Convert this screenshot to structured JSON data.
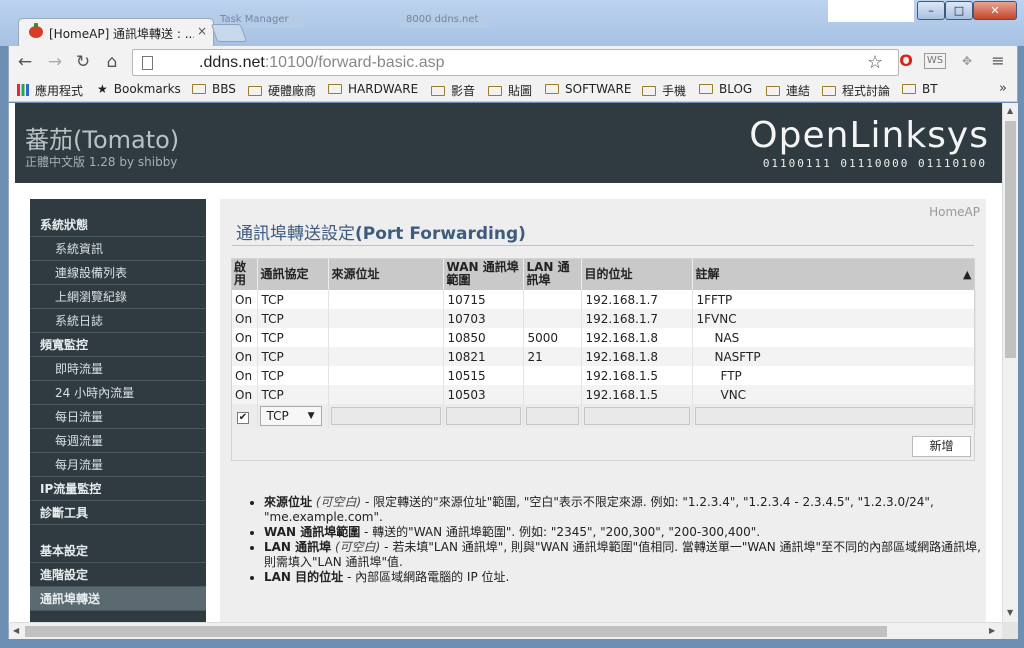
{
  "browser": {
    "tab_title": "[HomeAP] 通訊埠轉送 : ...",
    "tab_close": "×",
    "ghost_tabs": [
      "Task Manager",
      "8000 ddns.net"
    ],
    "url_host": ".ddns.net",
    "url_path": ":10100/forward-basic.asp",
    "bookmarks": [
      {
        "label": "應用程式",
        "type": "apps"
      },
      {
        "label": "Bookmarks",
        "type": "star"
      },
      {
        "label": "BBS",
        "type": "folder"
      },
      {
        "label": "硬體廠商",
        "type": "folder"
      },
      {
        "label": "HARDWARE",
        "type": "folder"
      },
      {
        "label": "影音",
        "type": "folder"
      },
      {
        "label": "貼圖",
        "type": "folder"
      },
      {
        "label": "SOFTWARE",
        "type": "folder"
      },
      {
        "label": "手機",
        "type": "folder"
      },
      {
        "label": "BLOG",
        "type": "folder"
      },
      {
        "label": "連結",
        "type": "folder"
      },
      {
        "label": "程式討論",
        "type": "folder"
      },
      {
        "label": "BT",
        "type": "folder"
      }
    ],
    "more": "»"
  },
  "header": {
    "brand": "蕃茄(Tomato)",
    "subtitle": "正體中文版 1.28 by shibby",
    "logo": "OpenLinksys",
    "logo_binary": "01100111 01110000 01110100"
  },
  "sidebar": [
    {
      "label": "系統狀態",
      "kind": "head"
    },
    {
      "label": "系統資訊",
      "kind": "sub"
    },
    {
      "label": "連線設備列表",
      "kind": "sub"
    },
    {
      "label": "上網瀏覽紀錄",
      "kind": "sub"
    },
    {
      "label": "系統日誌",
      "kind": "sub"
    },
    {
      "label": "頻寬監控",
      "kind": "head"
    },
    {
      "label": "即時流量",
      "kind": "sub"
    },
    {
      "label": "24 小時內流量",
      "kind": "sub"
    },
    {
      "label": "每日流量",
      "kind": "sub"
    },
    {
      "label": "每週流量",
      "kind": "sub"
    },
    {
      "label": "每月流量",
      "kind": "sub"
    },
    {
      "label": "IP流量監控",
      "kind": "head"
    },
    {
      "label": "診斷工具",
      "kind": "head"
    },
    {
      "label": "基本設定",
      "kind": "head"
    },
    {
      "label": "進階設定",
      "kind": "head"
    },
    {
      "label": "通訊埠轉送",
      "kind": "head active"
    }
  ],
  "content": {
    "breadcrumb": "HomeAP",
    "title_zh": "通訊埠轉送設定",
    "title_en": "(Port Forwarding)",
    "columns": [
      "啟用",
      "通訊協定",
      "來源位址",
      "WAN 通訊埠範圍",
      "LAN 通訊埠",
      "目的位址",
      "註解"
    ],
    "sort_indicator": "▲",
    "rows": [
      {
        "on": "On",
        "proto": "TCP",
        "src": "",
        "wan": "10715",
        "lan": "",
        "dest": "192.168.1.7",
        "note": "1FFTP"
      },
      {
        "on": "On",
        "proto": "TCP",
        "src": "",
        "wan": "10703",
        "lan": "",
        "dest": "192.168.1.7",
        "note": "1FVNC"
      },
      {
        "on": "On",
        "proto": "TCP",
        "src": "",
        "wan": "10850",
        "lan": "5000",
        "dest": "192.168.1.8",
        "note": "NAS"
      },
      {
        "on": "On",
        "proto": "TCP",
        "src": "",
        "wan": "10821",
        "lan": "21",
        "dest": "192.168.1.8",
        "note": "NASFTP"
      },
      {
        "on": "On",
        "proto": "TCP",
        "src": "",
        "wan": "10515",
        "lan": "",
        "dest": "192.168.1.5",
        "note": "FTP"
      },
      {
        "on": "On",
        "proto": "TCP",
        "src": "",
        "wan": "10503",
        "lan": "",
        "dest": "192.168.1.5",
        "note": "VNC"
      }
    ],
    "new_row": {
      "checkbox": "✔",
      "proto": "TCP",
      "caret": "▼"
    },
    "add_button": "新增",
    "notes": [
      {
        "term": "來源位址",
        "opt": "(可空白)",
        "text": " - 限定轉送的\"來源位址\"範圍, \"空白\"表示不限定來源. 例如: \"1.2.3.4\", \"1.2.3.4 - 2.3.4.5\", \"1.2.3.0/24\", \"me.example.com\"."
      },
      {
        "term": "WAN 通訊埠範圍",
        "opt": "",
        "text": " - 轉送的\"WAN 通訊埠範圍\". 例如: \"2345\", \"200,300\", \"200-300,400\"."
      },
      {
        "term": "LAN 通訊埠",
        "opt": "(可空白)",
        "text": " - 若未填\"LAN 通訊埠\", 則與\"WAN 通訊埠範圍\"值相同. 當轉送單一\"WAN 通訊埠\"至不同的內部區域網路通訊埠, 則需填入\"LAN 通訊埠\"值."
      },
      {
        "term": "LAN 目的位址",
        "opt": "",
        "text": " - 內部區域網路電腦的 IP 位址."
      }
    ]
  }
}
